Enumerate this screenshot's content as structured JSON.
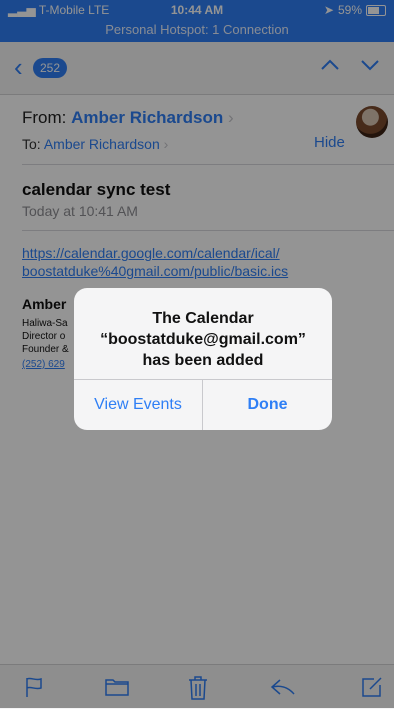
{
  "status_bar": {
    "carrier": "T-Mobile",
    "network": "LTE",
    "time": "10:44 AM",
    "battery_percent_text": "59%",
    "battery_level": 0.59,
    "hotspot": "Personal Hotspot: 1 Connection"
  },
  "nav": {
    "unread_count": "252"
  },
  "email": {
    "from_label": "From:",
    "from_name": "Amber Richardson",
    "to_label": "To:",
    "to_name": "Amber Richardson",
    "hide_label": "Hide",
    "subject": "calendar sync test",
    "date": "Today at 10:41 AM",
    "link_line1": "https://calendar.google.com/calendar/ical/",
    "link_line2": "boostatduke%40gmail.com/public/basic.ics",
    "signature": {
      "name": "Amber",
      "line1": "Haliwa-Sa",
      "line2": "Director o",
      "line3": "Founder &",
      "phone": "(252) 629"
    }
  },
  "alert": {
    "line1": "The Calendar",
    "line2": "“boostatduke@gmail.com”",
    "line3": "has been added",
    "view_events": "View Events",
    "done": "Done"
  },
  "toolbar": {
    "icons": [
      "flag-icon",
      "folder-icon",
      "trash-icon",
      "reply-icon",
      "compose-icon"
    ]
  },
  "colors": {
    "accent": "#2f7ff5",
    "status_bar_bg": "#2f7ff5"
  }
}
